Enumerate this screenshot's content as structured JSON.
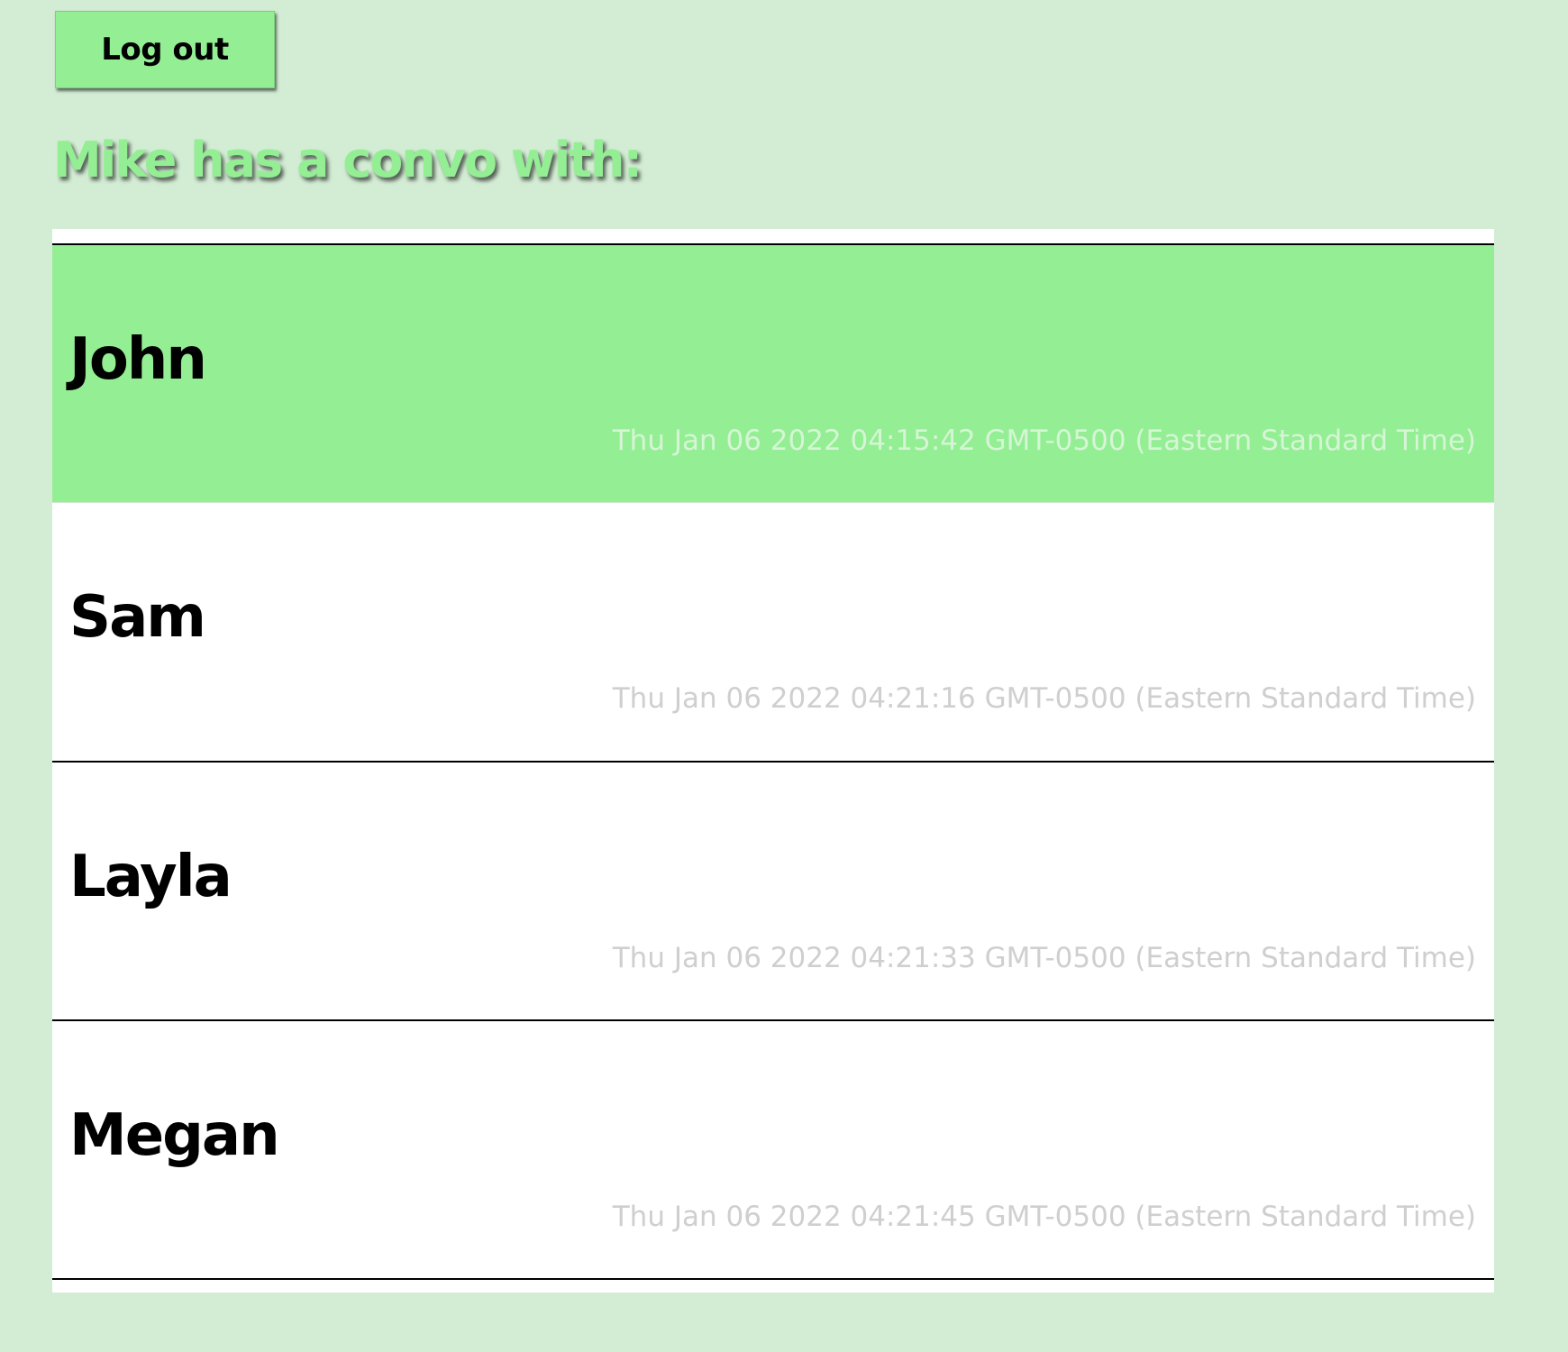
{
  "header": {
    "logout_label": "Log out",
    "title": "Mike has a convo with:"
  },
  "colors": {
    "page_background": "#d3ecd4",
    "accent_green": "#94ee94",
    "list_background": "#ffffff",
    "timestamp_gray": "#cfcfcf"
  },
  "conversations": [
    {
      "name": "John",
      "timestamp": "Thu Jan 06 2022 04:15:42 GMT-0500 (Eastern Standard Time)",
      "active": true
    },
    {
      "name": "Sam",
      "timestamp": "Thu Jan 06 2022 04:21:16 GMT-0500 (Eastern Standard Time)",
      "active": false
    },
    {
      "name": "Layla",
      "timestamp": "Thu Jan 06 2022 04:21:33 GMT-0500 (Eastern Standard Time)",
      "active": false
    },
    {
      "name": "Megan",
      "timestamp": "Thu Jan 06 2022 04:21:45 GMT-0500 (Eastern Standard Time)",
      "active": false
    }
  ]
}
